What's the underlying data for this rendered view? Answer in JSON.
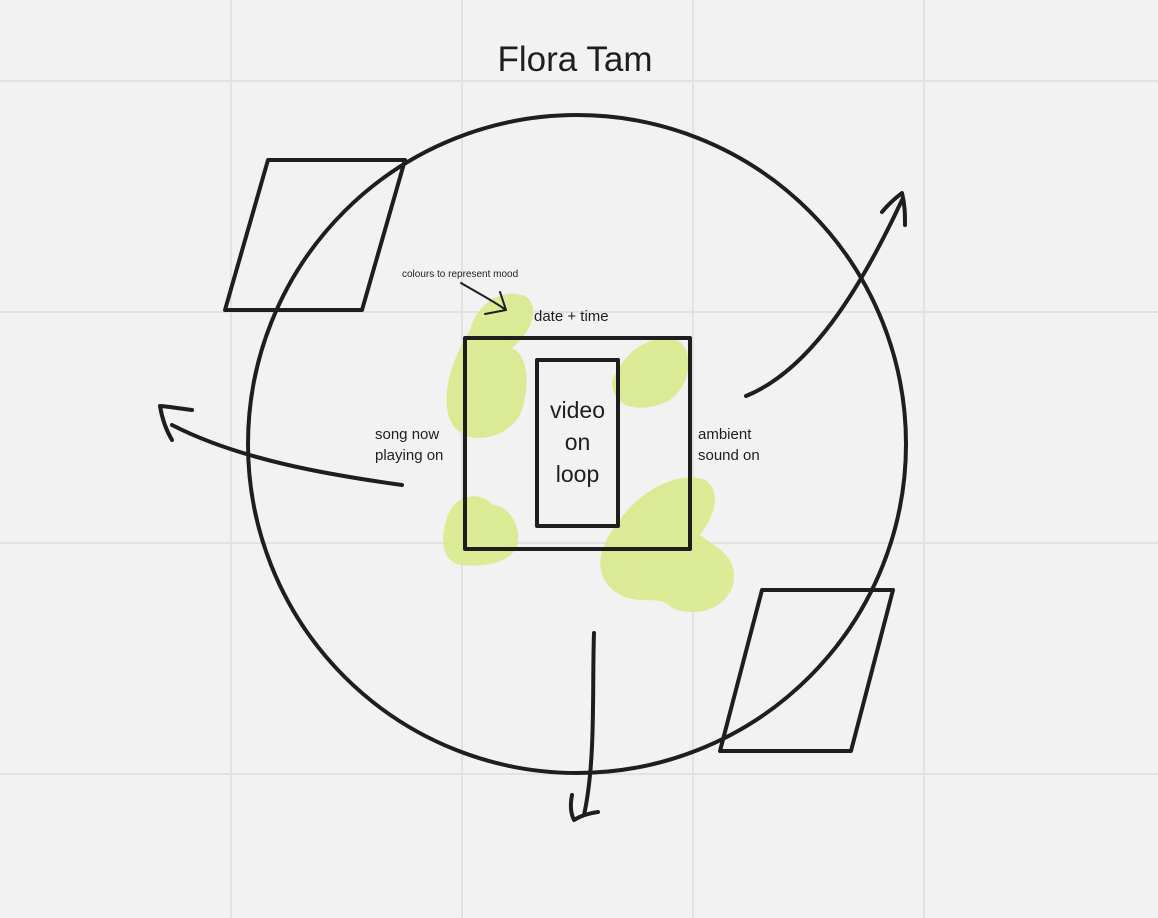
{
  "board": {
    "title": "Flora Tam",
    "background_color": "#f2f2f2",
    "grid_color": "#e2e2e2",
    "stroke_color": "#1e1e1e",
    "highlight_color": "#d9ea8c"
  },
  "notes": {
    "mood": "colours to represent mood",
    "datetime": "date + time",
    "song": "song now\nplaying on",
    "ambient": "ambient\nsound on",
    "video": "video\non\nloop"
  }
}
